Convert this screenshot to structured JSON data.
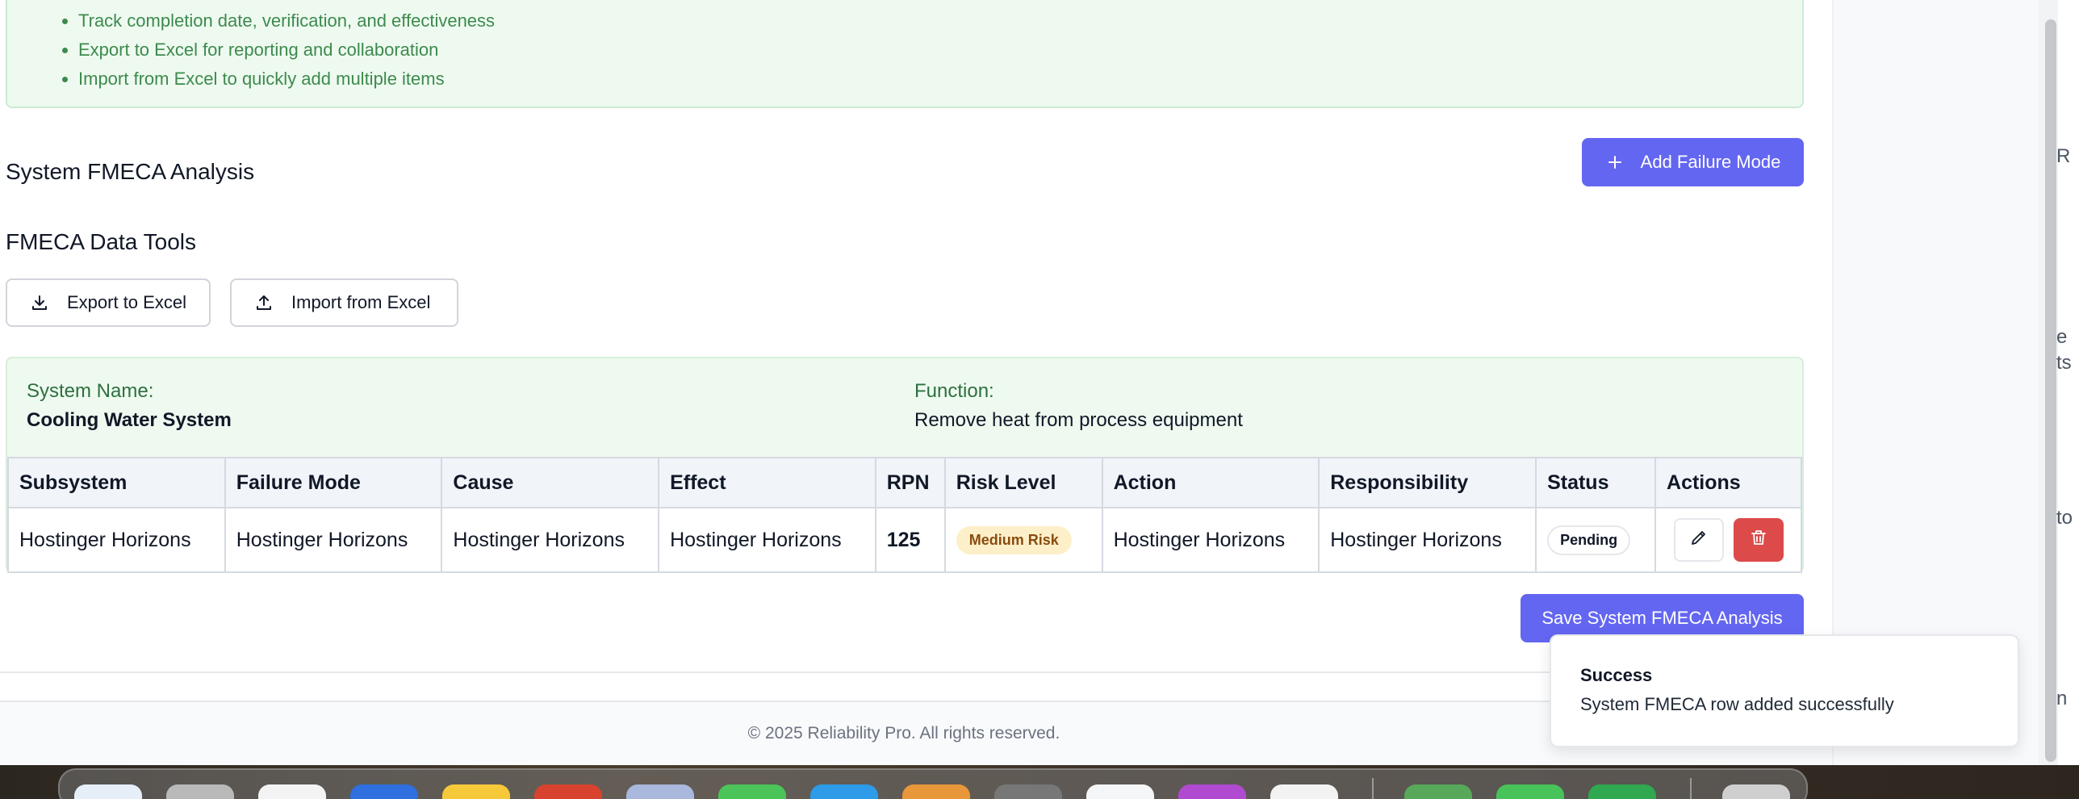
{
  "info_box": {
    "bullets": [
      "Track completion date, verification, and effectiveness",
      "Export to Excel for reporting and collaboration",
      "Import from Excel to quickly add multiple items"
    ]
  },
  "analysis_section": {
    "title": "System FMECA Analysis",
    "add_button_label": "Add Failure Mode"
  },
  "tools_section": {
    "title": "FMECA Data Tools",
    "export_label": "Export to Excel",
    "import_label": "Import from Excel"
  },
  "system": {
    "name_label": "System Name:",
    "name_value": "Cooling Water System",
    "function_label": "Function:",
    "function_value": "Remove heat from process equipment"
  },
  "table": {
    "headers": [
      "Subsystem",
      "Failure Mode",
      "Cause",
      "Effect",
      "RPN",
      "Risk Level",
      "Action",
      "Responsibility",
      "Status",
      "Actions"
    ],
    "rows": [
      {
        "subsystem": "Hostinger Horizons",
        "failure_mode": "Hostinger Horizons",
        "cause": "Hostinger Horizons",
        "effect": "Hostinger Horizons",
        "rpn": "125",
        "risk_level": "Medium Risk",
        "action": "Hostinger Horizons",
        "responsibility": "Hostinger Horizons",
        "status": "Pending"
      }
    ]
  },
  "save_button_label": "Save System FMECA Analysis",
  "footer": "© 2025 Reliability Pro. All rights reserved.",
  "toast": {
    "title": "Success",
    "message": "System FMECA row added successfully"
  },
  "edge_letters": [
    "R",
    "e",
    "ts",
    "to",
    "n"
  ],
  "colors": {
    "primary": "#6366f1",
    "danger": "#dc4a4a",
    "success_bg": "#eefaf0",
    "rpn": "#d97706",
    "risk_badge_bg": "#fdf0c9"
  },
  "dock_icons": [
    "finder-icon",
    "launchpad-icon",
    "photos-icon",
    "mail-icon",
    "notes-icon",
    "chrome-icon",
    "preview-icon",
    "messages-icon",
    "appstore-icon",
    "pages-icon",
    "settings-icon",
    "calendar-icon",
    "podcasts-icon",
    "safari-icon",
    "maps-icon",
    "facetime-icon",
    "numbers-icon",
    "trash-icon"
  ]
}
